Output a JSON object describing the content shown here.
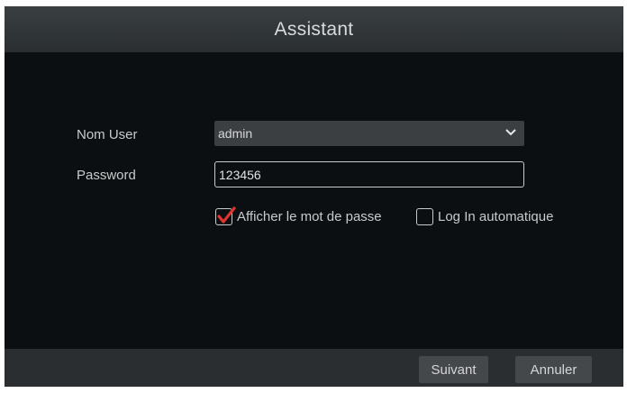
{
  "dialog": {
    "title": "Assistant"
  },
  "form": {
    "username_label": "Nom User",
    "username_value": "admin",
    "password_label": "Password",
    "password_value": "123456",
    "show_password": {
      "label": "Afficher le mot de passe",
      "checked": true
    },
    "auto_login": {
      "label": "Log In automatique",
      "checked": false
    }
  },
  "footer": {
    "next_label": "Suivant",
    "cancel_label": "Annuler"
  },
  "colors": {
    "checkmark": "#e0342c",
    "background": "#0b0f11",
    "titlebar": "#33373a"
  },
  "icons": {
    "dropdown": "chevron-down-icon",
    "check": "checkmark-icon"
  }
}
